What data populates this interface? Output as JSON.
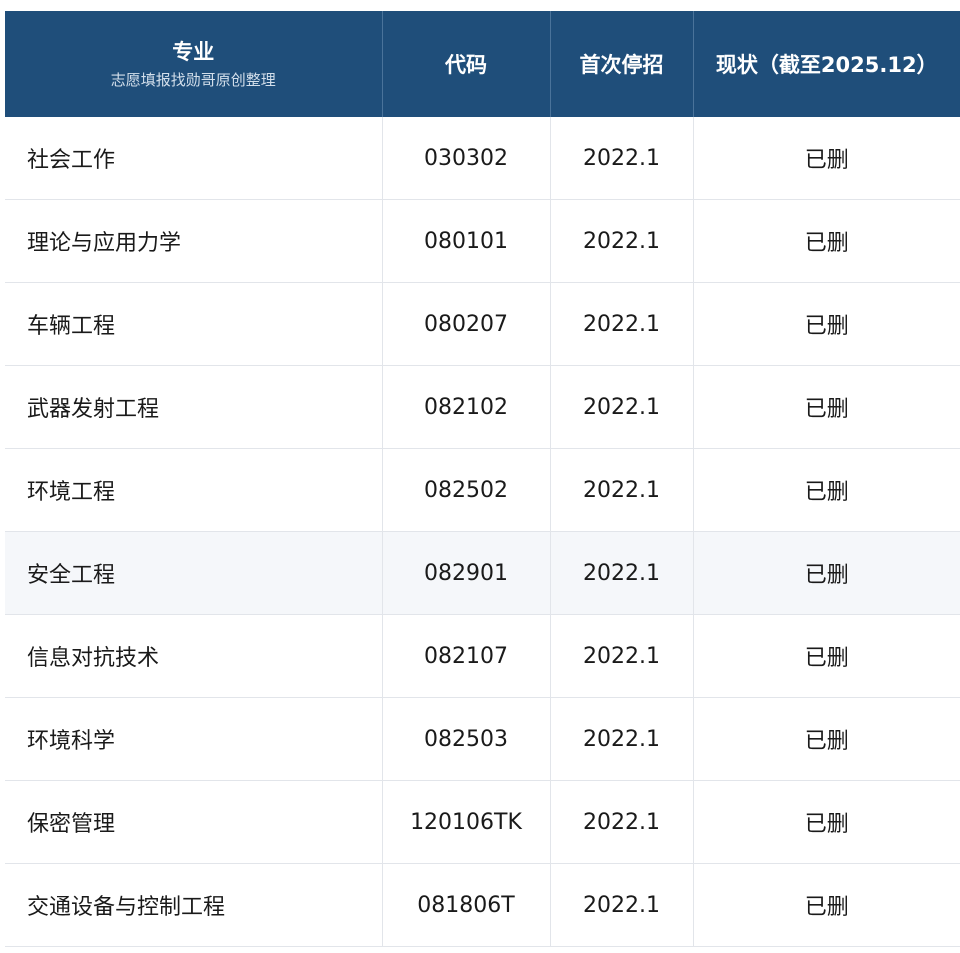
{
  "header": {
    "major": "专业",
    "watermark": "志愿填报找勋哥原创整理",
    "code": "代码",
    "first_stop": "首次停招",
    "status": "现状（截至2025.12）"
  },
  "rows": [
    {
      "name": "社会工作",
      "code": "030302",
      "first_stop": "2022.1",
      "status": "已删"
    },
    {
      "name": "理论与应用力学",
      "code": "080101",
      "first_stop": "2022.1",
      "status": "已删"
    },
    {
      "name": "车辆工程",
      "code": "080207",
      "first_stop": "2022.1",
      "status": "已删"
    },
    {
      "name": "武器发射工程",
      "code": "082102",
      "first_stop": "2022.1",
      "status": "已删"
    },
    {
      "name": "环境工程",
      "code": "082502",
      "first_stop": "2022.1",
      "status": "已删"
    },
    {
      "name": "安全工程",
      "code": "082901",
      "first_stop": "2022.1",
      "status": "已删"
    },
    {
      "name": "信息对抗技术",
      "code": "082107",
      "first_stop": "2022.1",
      "status": "已删"
    },
    {
      "name": "环境科学",
      "code": "082503",
      "first_stop": "2022.1",
      "status": "已删"
    },
    {
      "name": "保密管理",
      "code": "120106TK",
      "first_stop": "2022.1",
      "status": "已删"
    },
    {
      "name": "交通设备与控制工程",
      "code": "081806T",
      "first_stop": "2022.1",
      "status": "已删"
    }
  ],
  "colors": {
    "header_bg": "#1f4e7a",
    "highlight_row": "#f5f7fa"
  }
}
